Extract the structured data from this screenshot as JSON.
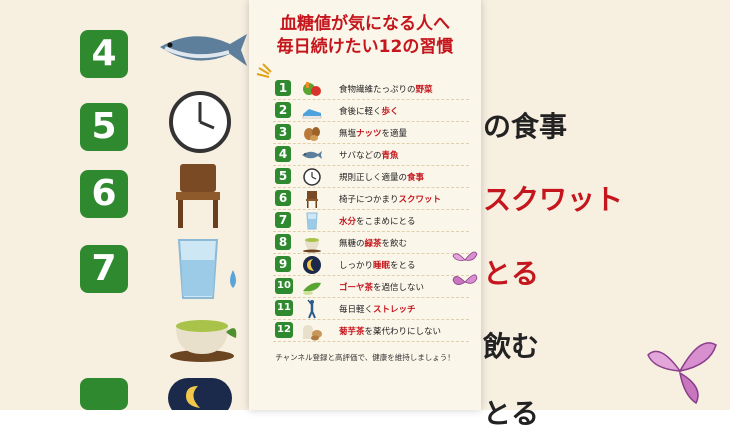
{
  "title": {
    "line1": "血糖値が気になる人へ",
    "line2": "毎日続けたい12の習慣"
  },
  "items": [
    {
      "num": "1",
      "pre": "食物繊維たっぷりの",
      "hl": "野菜",
      "post": "",
      "icon": "vegetables-icon"
    },
    {
      "num": "2",
      "pre": "食後に軽く",
      "hl": "歩く",
      "post": "",
      "icon": "sneaker-icon"
    },
    {
      "num": "3",
      "pre": "無塩",
      "hl": "ナッツ",
      "post": "を適量",
      "icon": "nuts-icon"
    },
    {
      "num": "4",
      "pre": "サバなどの",
      "hl": "青魚",
      "post": "",
      "icon": "fish-icon"
    },
    {
      "num": "5",
      "pre": "規則正しく適量の",
      "hl": "食事",
      "post": "",
      "icon": "clock-icon"
    },
    {
      "num": "6",
      "pre": "椅子につかまり",
      "hl": "スクワット",
      "post": "",
      "icon": "chair-icon"
    },
    {
      "num": "7",
      "pre": "",
      "hl": "水分",
      "post": "をこまめにとる",
      "icon": "water-glass-icon"
    },
    {
      "num": "8",
      "pre": "無糖の",
      "hl": "緑茶",
      "post": "を飲む",
      "icon": "green-tea-icon"
    },
    {
      "num": "9",
      "pre": "しっかり",
      "hl": "睡眠",
      "post": "をとる",
      "icon": "moon-icon"
    },
    {
      "num": "10",
      "pre": "",
      "hl": "ゴーヤ茶",
      "post": "を過信しない",
      "icon": "bitter-melon-icon"
    },
    {
      "num": "11",
      "pre": "毎日軽く",
      "hl": "ストレッチ",
      "post": "",
      "icon": "stretch-person-icon"
    },
    {
      "num": "12",
      "pre": "",
      "hl": "菊芋茶",
      "post": "を薬代わりにしない",
      "icon": "sunchoke-icon"
    }
  ],
  "footer": "チャンネル登録と高評価で、健康を維持しましょう！",
  "background": {
    "numbers": [
      "4",
      "5",
      "6",
      "7"
    ],
    "texts": [
      "の食事",
      "スクワット",
      "とる",
      "飲む",
      "とる"
    ]
  },
  "colors": {
    "accent": "#c4161c",
    "badge": "#2f8a2f",
    "card": "#fbf6ea"
  }
}
